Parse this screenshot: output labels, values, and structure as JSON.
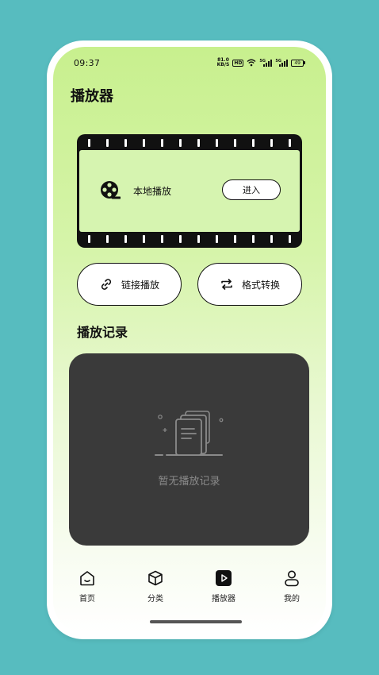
{
  "status_bar": {
    "time": "09:37",
    "net_speed_value": "81.0",
    "net_speed_unit": "KB/S",
    "hd_badge": "HD",
    "sim1_label": "5G",
    "sim2_label": "5G",
    "battery": "49"
  },
  "header": {
    "title": "播放器"
  },
  "local_card": {
    "label": "本地播放",
    "enter_label": "进入",
    "icon": "film-reel-icon"
  },
  "actions": {
    "link_play": {
      "label": "链接播放",
      "icon": "link-icon"
    },
    "format_convert": {
      "label": "格式转换",
      "icon": "swap-arrows-icon"
    }
  },
  "history": {
    "title": "播放记录",
    "empty_text": "暂无播放记录",
    "icon": "empty-documents-icon"
  },
  "tab_bar": {
    "tabs": [
      {
        "label": "首页",
        "icon": "home-icon"
      },
      {
        "label": "分类",
        "icon": "cube-icon"
      },
      {
        "label": "播放器",
        "icon": "play-square-icon"
      },
      {
        "label": "我的",
        "icon": "person-icon"
      }
    ],
    "active": "播放器"
  },
  "colors": {
    "background": "#57bcbf",
    "accent_green": "#c8f08e",
    "panel_dark": "#3a3a3a"
  }
}
